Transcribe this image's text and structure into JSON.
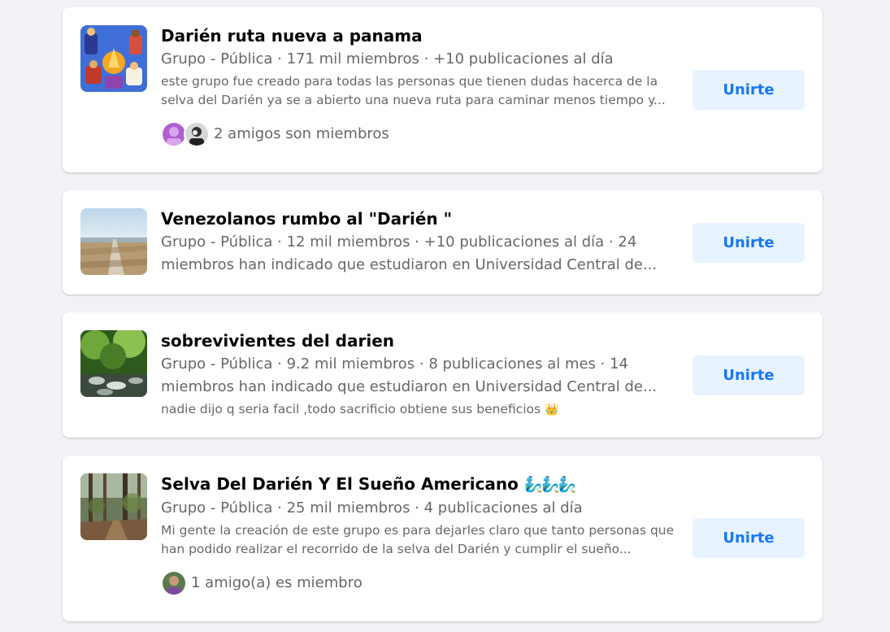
{
  "groups": [
    {
      "name": "Darién ruta nueva a panama",
      "meta": "Grupo - Pública · 171 mil miembros · +10 publicaciones al día",
      "description": "este grupo fue creado para todas las personas que tienen dudas hacerca de la selva del Darién ya se a abierto una nueva ruta para caminar menos tiempo y...",
      "friends_text": "2 amigos son miembros",
      "join_label": "Unirte"
    },
    {
      "name": "Venezolanos rumbo al \"Darién \"",
      "meta": "Grupo - Pública · 12 mil miembros · +10 publicaciones al día · 24 miembros han indicado que estudiaron en Universidad Central de...",
      "join_label": "Unirte"
    },
    {
      "name": "sobrevivientes del darien",
      "meta": "Grupo - Pública · 9.2 mil miembros · 8 publicaciones al mes · 14 miembros han indicado que estudiaron en Universidad Central de...",
      "description": "nadie dijo q seria facil ,todo sacrificio obtiene sus beneficios",
      "description_emoji": "👑",
      "join_label": "Unirte"
    },
    {
      "name": "Selva Del Darién Y El Sueño Americano",
      "name_emoji": "🧞‍♂️🧞‍♂️🧞‍♂️",
      "meta": "Grupo - Pública · 25 mil miembros · 4 publicaciones al día",
      "description": "Mi gente la creación de este grupo es para dejarles claro que tanto personas que han podido realizar el recorrido de la selva del Darién y cumplir el sueño...",
      "friends_text": "1 amigo(a) es miembro",
      "join_label": "Unirte"
    }
  ],
  "colors": {
    "page_bg": "#f0f2f5",
    "card_bg": "#ffffff",
    "title": "#050505",
    "secondary_text": "#65676b",
    "button_bg": "#e7f3ff",
    "button_text": "#1877f2"
  }
}
